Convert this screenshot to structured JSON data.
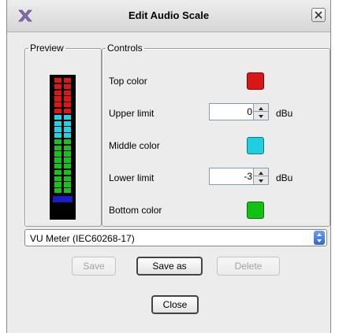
{
  "dialog": {
    "title": "Edit Audio Scale",
    "logo_icon": "x-logo-icon",
    "close_icon": "close-icon"
  },
  "preview": {
    "legend": "Preview",
    "segments_top_to_bottom": [
      "red",
      "red",
      "red",
      "red",
      "red",
      "red",
      "cyan",
      "cyan",
      "cyan",
      "cyan",
      "green",
      "green",
      "green",
      "green",
      "green",
      "green",
      "green",
      "green",
      "green"
    ],
    "colors": {
      "red": "#e01616",
      "cyan": "#1fd2e6",
      "green": "#17c21a",
      "blue": "#1b1bc8"
    }
  },
  "controls": {
    "legend": "Controls",
    "top_color": {
      "label": "Top color",
      "color": "#d81818"
    },
    "upper_limit": {
      "label": "Upper limit",
      "value": "0",
      "unit": "dBu"
    },
    "middle_color": {
      "label": "Middle color",
      "color": "#1fcfe0"
    },
    "lower_limit": {
      "label": "Lower limit",
      "value": "-3",
      "unit": "dBu"
    },
    "bottom_color": {
      "label": "Bottom color",
      "color": "#12c212"
    }
  },
  "preset": {
    "selected": "VU Meter (IEC60268-17)"
  },
  "buttons": {
    "save": "Save",
    "save_as": "Save as",
    "delete": "Delete",
    "close": "Close"
  }
}
